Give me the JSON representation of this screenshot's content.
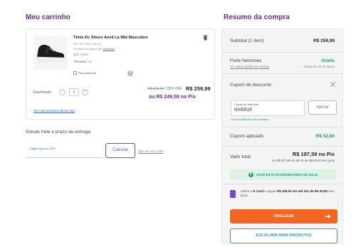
{
  "cart": {
    "title": "Meu carrinho",
    "product": {
      "name": "Tênis Dc Shoes Anvil La Mid Masculino",
      "ref": "Ref.: PFI-2421-006-45",
      "sold_by_prefix": "Vendido e entregue por",
      "seller": "Netshoes",
      "color_label": "Cor:",
      "color_value": "Preto",
      "size_label": "Tamanho:",
      "size_value": "43",
      "gift_label": "Para presente",
      "qty_label": "Quantidade:",
      "qty_value": "1",
      "old_price": "R$ 349,99",
      "discount": "| 25% OFF",
      "price": "R$ 259,99",
      "pix_price": "ou R$ 249,59 no Pix",
      "more_link": "Ver mais produtos dessa loja"
    },
    "shipping": {
      "title": "Simule frete e prazo de entrega",
      "cep_placeholder": "Digite aqui seu CEP",
      "calc_label": "Calcular",
      "no_cep_link": "Não sei meu CEP"
    }
  },
  "summary": {
    "title": "Resumo da compra",
    "subtotal_label": "Subtotal (1 item)",
    "subtotal_value": "R$ 259,99",
    "freight_label": "Frete Netshoes",
    "freight_value": "Grátis",
    "freight_options_link": "Ver outras opções de entrega",
    "freight_date": "Chega dia 15 de Março",
    "coupon_title": "Cupom de desconto",
    "coupon_field_label": "Cupom de desconto",
    "coupon_value": "NIVER20",
    "coupon_apply": "Aplicar",
    "coupon_success": "Cupom aplicado com sucesso",
    "coupon_applied_label": "Cupom aplicado",
    "coupon_applied_value": "R$ 52,00",
    "total_label": "Valor total",
    "total_pix": "R$ 197,59 no Pix",
    "total_installments": "ou R$ 207,99 em até 3x de R$ 69,33 sem juros",
    "economy": "VOCÊ ESTÁ ECONOMIZANDO R$ 152,31",
    "ncard_text_1": "Utilize o",
    "ncard_name": "N Card",
    "ncard_text_2": "e pague",
    "ncard_price": "R$ 208,00 em até 10x de R$ 20,80",
    "ncard_text_3": "sem juros",
    "finalize_label": "FINALIZAR",
    "more_products_label": "ESCOLHER MAIS PRODUTOS"
  },
  "colors": {
    "brand_purple": "#6b2c8e",
    "finalize_orange": "#f26522",
    "success_green": "#1e9e5a",
    "link_blue": "#3a64c8"
  }
}
